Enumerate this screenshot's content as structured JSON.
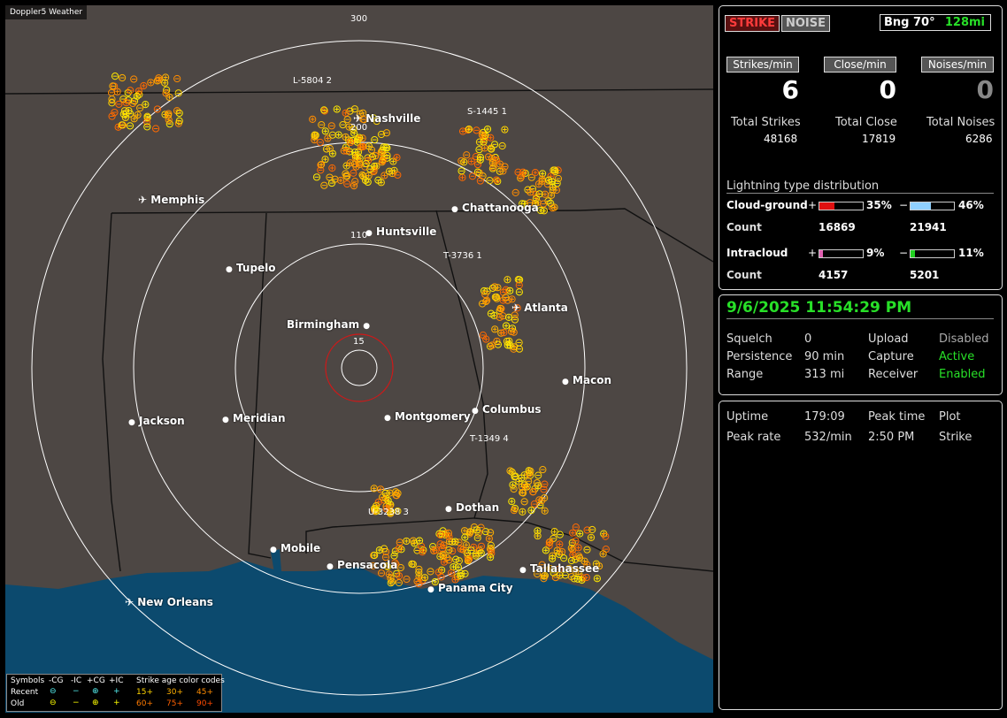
{
  "map": {
    "title": "Doppler5 Weather",
    "range_labels": {
      "r300": "300",
      "r200": "200",
      "r110": "110",
      "r15": "15"
    },
    "cities": {
      "nashville": "Nashville",
      "memphis": "Memphis",
      "chattanooga": "Chattanooga",
      "huntsville": "Huntsville",
      "tupelo": "Tupelo",
      "birmingham": "Birmingham",
      "atlanta": "Atlanta",
      "macon": "Macon",
      "jackson": "Jackson",
      "meridian": "Meridian",
      "montgomery": "Montgomery",
      "columbus": "Columbus",
      "dotha": "Dothan",
      "mobile": "Mobile",
      "pensacola": "Pensacola",
      "tallahassee": "Tallahassee",
      "panama_city": "Panama City",
      "new_orleans": "New Orleans"
    },
    "cells": {
      "c1": "L-5804  2",
      "c2": "S-1445  1",
      "c3": "T-3736  1",
      "c4": "T-1349  4",
      "c5": "U-3238  3"
    },
    "colors": {
      "land": "#4d4744",
      "water": "#0c4a6e",
      "ring": "#ffffff",
      "close_ring": "#d01818"
    }
  },
  "legend": {
    "symbols": "Symbols",
    "neg_cg": "-CG",
    "neg_ic": "-IC",
    "pos_cg": "+CG",
    "pos_ic": "+IC",
    "age_title": "Strike age color codes",
    "recent": "Recent",
    "old": "Old",
    "a15": "15+",
    "a30": "30+",
    "a45": "45+",
    "a60": "60+",
    "a75": "75+",
    "a90": "90+"
  },
  "status": {
    "strike_btn": "STRIKE",
    "noise_btn": "NOISE",
    "bearing": "Bng 70°",
    "distance": "128mi",
    "strikes_per_min_label": "Strikes/min",
    "close_per_min_label": "Close/min",
    "noises_per_min_label": "Noises/min",
    "strikes_per_min": "6",
    "close_per_min": "0",
    "noises_per_min": "0",
    "total_strikes_label": "Total Strikes",
    "total_close_label": "Total Close",
    "total_noises_label": "Total Noises",
    "total_strikes": "48168",
    "total_close": "17819",
    "total_noises": "6286",
    "dist_title": "Lightning type distribution",
    "cg_label": "Cloud-ground",
    "cg_pos_pct": "35%",
    "cg_neg_pct": "46%",
    "cg_pos_frac": 0.35,
    "cg_neg_frac": 0.46,
    "count_label": "Count",
    "cg_pos_count": "16869",
    "cg_neg_count": "21941",
    "ic_label": "Intracloud",
    "ic_pos_pct": "9%",
    "ic_neg_pct": "11%",
    "ic_pos_frac": 0.09,
    "ic_neg_frac": 0.11,
    "ic_pos_count": "4157",
    "ic_neg_count": "5201",
    "plus": "+",
    "minus": "−"
  },
  "info": {
    "datetime": "9/6/2025 11:54:29 PM",
    "squelch_label": "Squelch",
    "squelch": "0",
    "upload_label": "Upload",
    "upload": "Disabled",
    "persistence_label": "Persistence",
    "persistence": "90 min",
    "capture_label": "Capture",
    "capture": "Active",
    "range_label": "Range",
    "range": "313 mi",
    "receiver_label": "Receiver",
    "receiver": "Enabled"
  },
  "stats": {
    "uptime_label": "Uptime",
    "uptime": "179:09",
    "peak_time_label": "Peak time",
    "plot_label": "Plot",
    "peak_rate_label": "Peak rate",
    "peak_rate": "532/min",
    "peak_time": "2:50 PM",
    "plot": "Strike"
  }
}
